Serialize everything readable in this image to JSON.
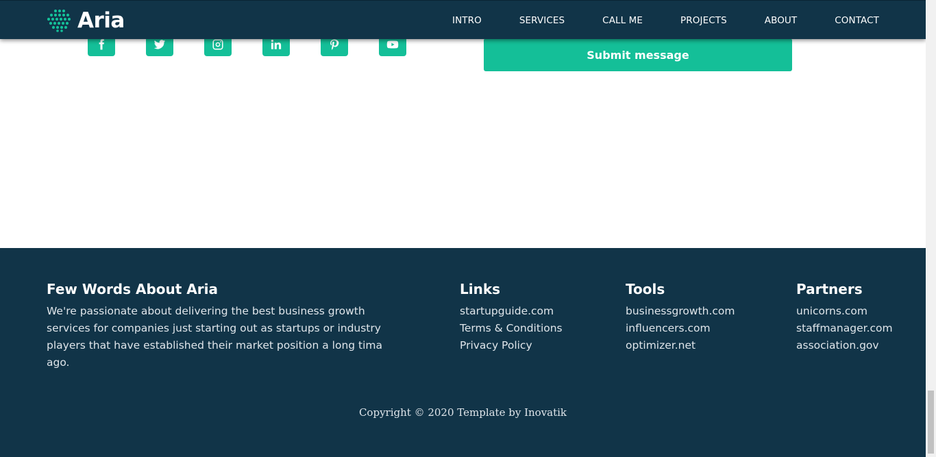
{
  "brand": {
    "name": "Aria",
    "logo_icon": "dot-grid-logo-icon"
  },
  "nav": {
    "items": [
      {
        "label": "INTRO"
      },
      {
        "label": "SERVICES"
      },
      {
        "label": "CALL ME"
      },
      {
        "label": "PROJECTS"
      },
      {
        "label": "ABOUT"
      },
      {
        "label": "CONTACT"
      }
    ]
  },
  "social": {
    "icons": [
      "facebook-icon",
      "twitter-icon",
      "instagram-icon",
      "linkedin-icon",
      "pinterest-icon",
      "youtube-icon"
    ]
  },
  "form": {
    "submit_label": "Submit message"
  },
  "footer": {
    "about": {
      "title": "Few Words About Aria",
      "text": "We're passionate about delivering the best business growth services for companies just starting out as startups or industry players that have established their market position a long tima ago."
    },
    "links": {
      "title": "Links",
      "items": [
        "startupguide.com",
        "Terms & Conditions",
        "Privacy Policy"
      ]
    },
    "tools": {
      "title": "Tools",
      "items": [
        "businessgrowth.com",
        "influencers.com",
        "optimizer.net"
      ]
    },
    "partners": {
      "title": "Partners",
      "items": [
        "unicorns.com",
        "staffmanager.com",
        "association.gov"
      ]
    },
    "copyright": "Copyright © 2020 Template by Inovatik"
  },
  "colors": {
    "primary": "#14bf98",
    "dark": "#113448",
    "footer_text": "#dfe5ea"
  }
}
